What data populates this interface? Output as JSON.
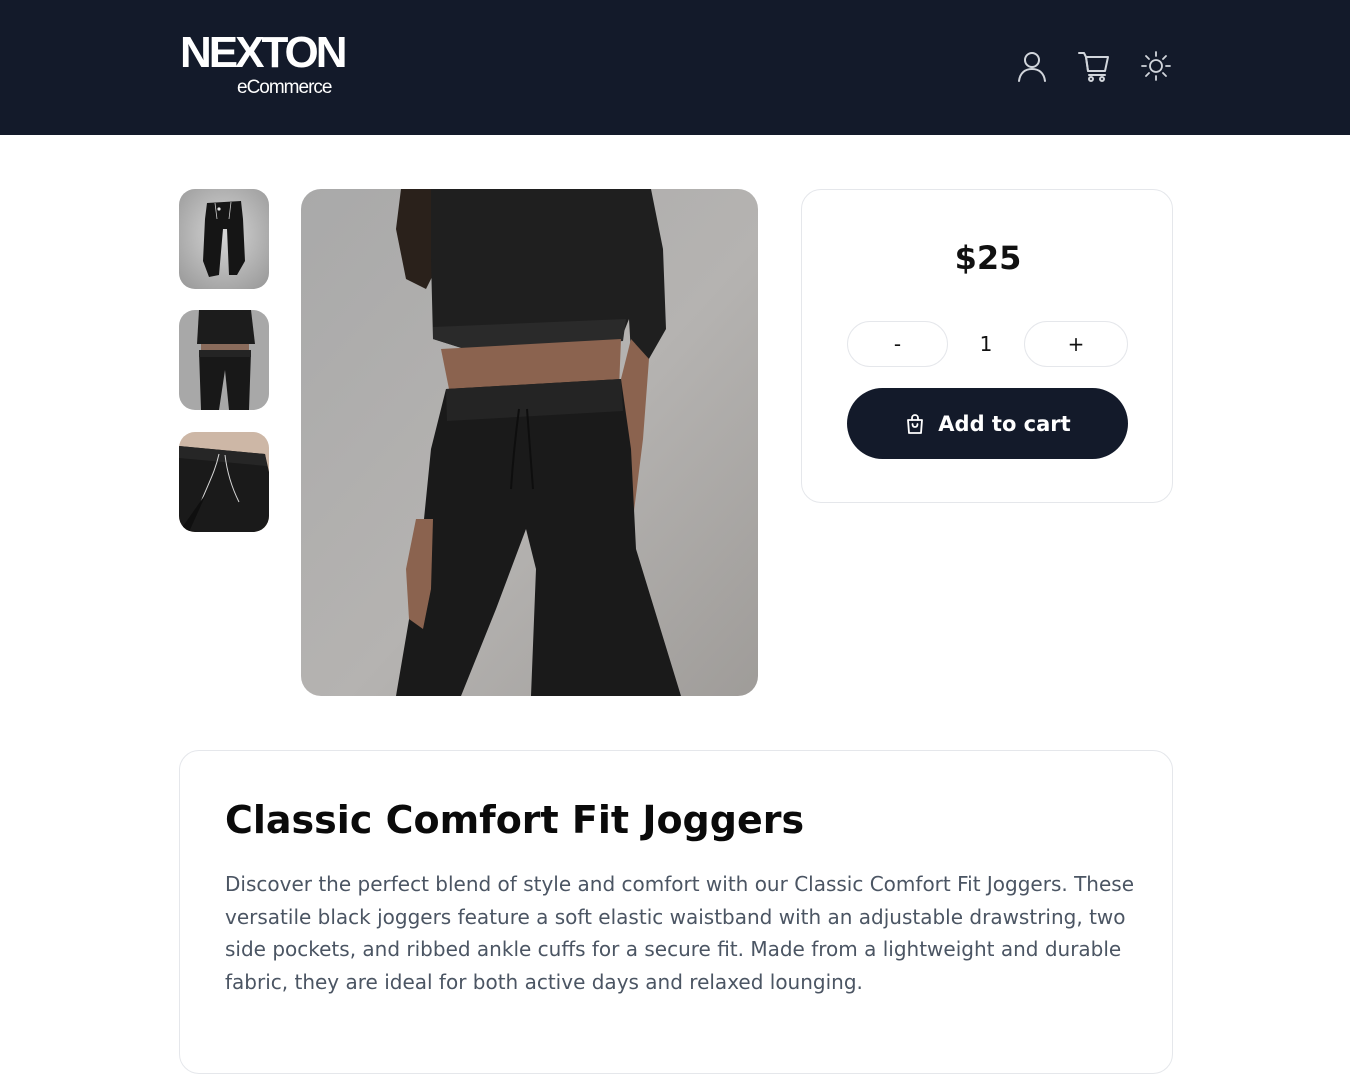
{
  "header": {
    "logo_main": "NEXTON",
    "logo_sub": "eCommerce",
    "icons": [
      "user-icon",
      "cart-icon",
      "sun-icon"
    ],
    "background_color": "#131a2a"
  },
  "gallery": {
    "thumbnails": [
      "joggers-flat-lay",
      "model-wearing-joggers",
      "waistband-closeup"
    ]
  },
  "purchase": {
    "price": "$25",
    "quantity_minus": "-",
    "quantity": "1",
    "quantity_plus": "+",
    "add_to_cart_label": "Add to cart",
    "add_to_cart_icon": "shopping-bag-icon",
    "button_color": "#131a2a"
  },
  "product": {
    "title": "Classic Comfort Fit Joggers",
    "description": "Discover the perfect blend of style and comfort with our Classic Comfort Fit Joggers. These versatile black joggers feature a soft elastic waistband with an adjustable drawstring, two side pockets, and ribbed ankle cuffs for a secure fit. Made from a lightweight and durable fabric, they are ideal for both active days and relaxed lounging."
  }
}
